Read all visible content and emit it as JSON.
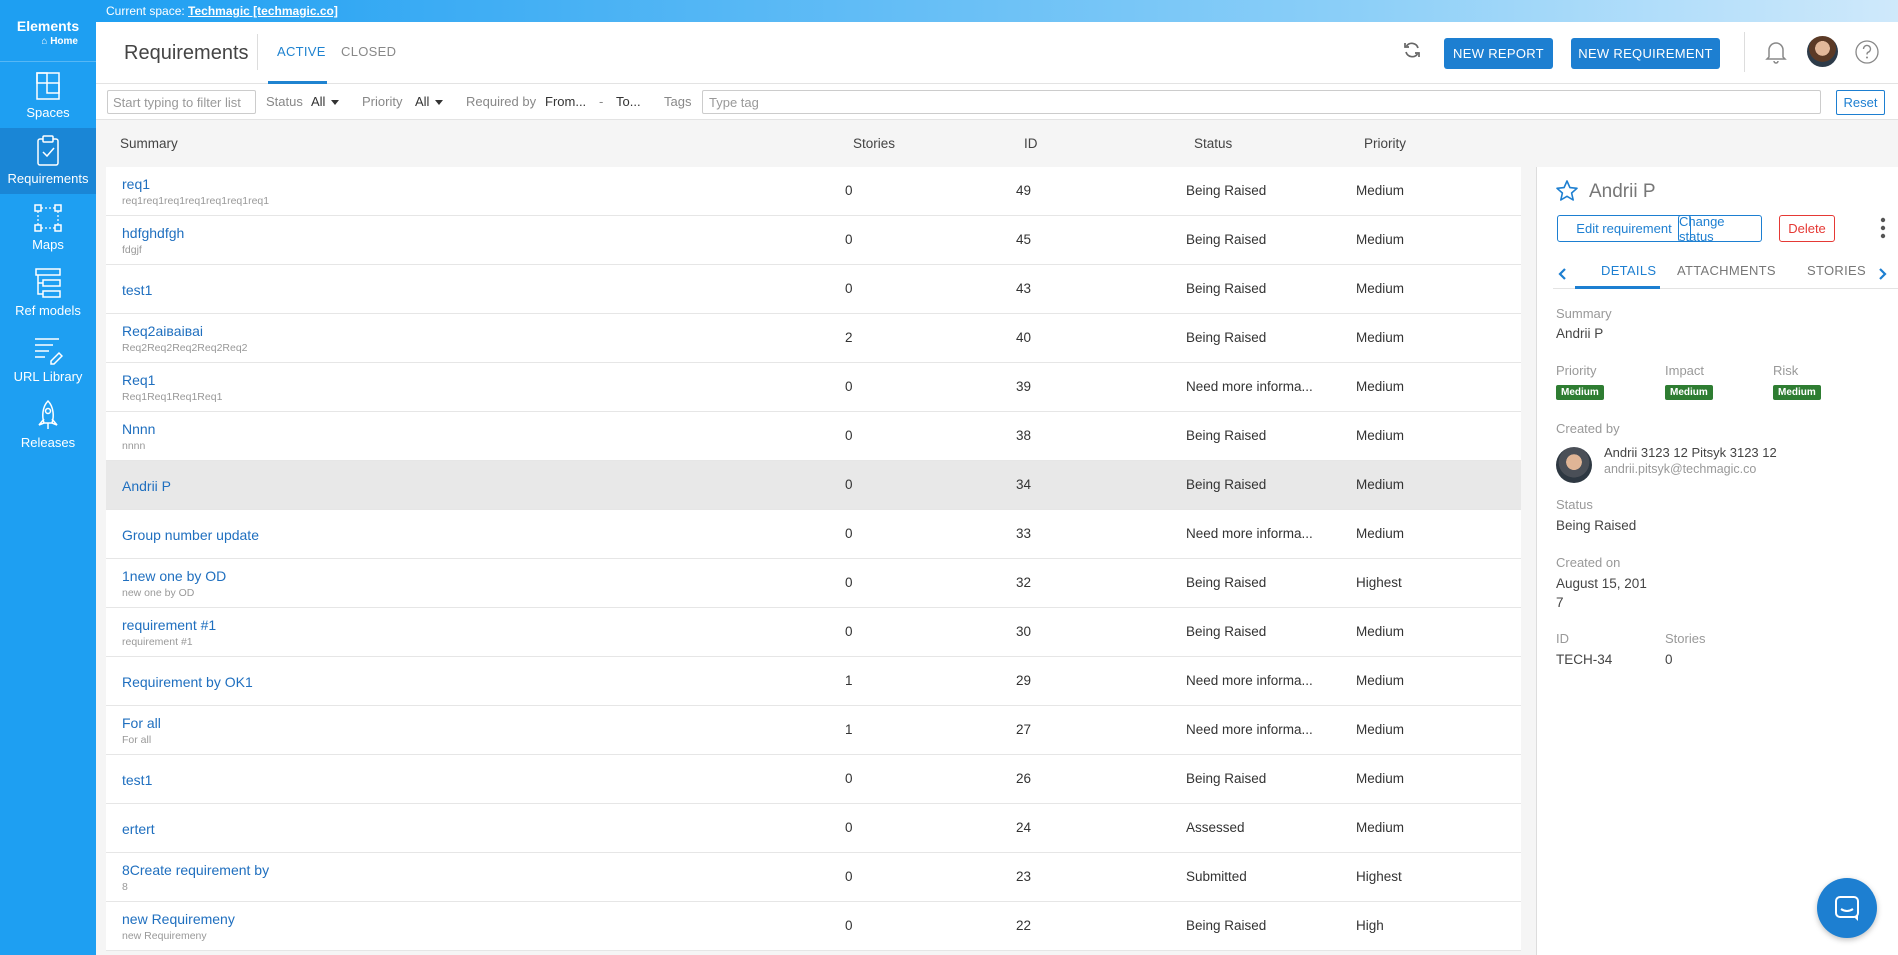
{
  "sidebar": {
    "brand": "Elements",
    "home": "Home",
    "items": [
      {
        "label": "Spaces",
        "icon": "spaces-icon"
      },
      {
        "label": "Requirements",
        "icon": "clipboard-icon"
      },
      {
        "label": "Maps",
        "icon": "maps-icon"
      },
      {
        "label": "Ref models",
        "icon": "ref-models-icon"
      },
      {
        "label": "URL Library",
        "icon": "url-library-icon"
      },
      {
        "label": "Releases",
        "icon": "rocket-icon"
      }
    ]
  },
  "space": {
    "prefix": "Current space:",
    "name": "Techmagic [techmagic.co]"
  },
  "header": {
    "title": "Requirements",
    "tabs": [
      "ACTIVE",
      "CLOSED"
    ],
    "new_report": "NEW REPORT",
    "new_requirement": "NEW REQUIREMENT"
  },
  "filters": {
    "search_placeholder": "Start typing to filter list",
    "status_label": "Status",
    "status_value": "All",
    "priority_label": "Priority",
    "priority_value": "All",
    "required_by_label": "Required by",
    "from": "From...",
    "dash": "-",
    "to": "To...",
    "tags_label": "Tags",
    "tags_placeholder": "Type tag",
    "reset": "Reset"
  },
  "table": {
    "columns": [
      "Summary",
      "Stories",
      "ID",
      "Status",
      "Priority"
    ],
    "rows": [
      {
        "summary": "req1",
        "sub": "req1req1req1req1req1req1req1",
        "stories": "0",
        "id": "49",
        "status": "Being Raised",
        "priority": "Medium"
      },
      {
        "summary": "hdfghdfgh",
        "sub": "fdgjf",
        "stories": "0",
        "id": "45",
        "status": "Being Raised",
        "priority": "Medium"
      },
      {
        "summary": "test1",
        "sub": "",
        "stories": "0",
        "id": "43",
        "status": "Being Raised",
        "priority": "Medium"
      },
      {
        "summary": "Req2aiвaiвai",
        "sub": "Req2Req2Req2Req2Req2",
        "stories": "2",
        "id": "40",
        "status": "Being Raised",
        "priority": "Medium"
      },
      {
        "summary": "Req1",
        "sub": "Req1Req1Req1Req1",
        "stories": "0",
        "id": "39",
        "status": "Need more informa...",
        "priority": "Medium"
      },
      {
        "summary": "Nnnn",
        "sub": "nnnn",
        "stories": "0",
        "id": "38",
        "status": "Being Raised",
        "priority": "Medium"
      },
      {
        "summary": "Andrii P",
        "sub": "",
        "stories": "0",
        "id": "34",
        "status": "Being Raised",
        "priority": "Medium"
      },
      {
        "summary": "Group number update",
        "sub": "",
        "stories": "0",
        "id": "33",
        "status": "Need more informa...",
        "priority": "Medium"
      },
      {
        "summary": "1new one by OD",
        "sub": "new one by OD",
        "stories": "0",
        "id": "32",
        "status": "Being Raised",
        "priority": "Highest"
      },
      {
        "summary": "requirement #1",
        "sub": "requirement #1",
        "stories": "0",
        "id": "30",
        "status": "Being Raised",
        "priority": "Medium"
      },
      {
        "summary": "Requirement by OK1",
        "sub": "",
        "stories": "1",
        "id": "29",
        "status": "Need more informa...",
        "priority": "Medium"
      },
      {
        "summary": "For all",
        "sub": "For all",
        "stories": "1",
        "id": "27",
        "status": "Need more informa...",
        "priority": "Medium"
      },
      {
        "summary": "test1",
        "sub": "",
        "stories": "0",
        "id": "26",
        "status": "Being Raised",
        "priority": "Medium"
      },
      {
        "summary": "ertert",
        "sub": "",
        "stories": "0",
        "id": "24",
        "status": "Assessed",
        "priority": "Medium"
      },
      {
        "summary": "8Create requirement by",
        "sub": "8",
        "stories": "0",
        "id": "23",
        "status": "Submitted",
        "priority": "Highest"
      },
      {
        "summary": "new Requiremeny",
        "sub": "new Requiremeny",
        "stories": "0",
        "id": "22",
        "status": "Being Raised",
        "priority": "High"
      }
    ],
    "selected_index": 6
  },
  "detail": {
    "title": "Andrii P",
    "edit": "Edit requirement",
    "change_status": "Change status",
    "delete": "Delete",
    "tabs": [
      "DETAILS",
      "ATTACHMENTS",
      "STORIES"
    ],
    "summary_label": "Summary",
    "summary_value": "Andrii P",
    "priority_label": "Priority",
    "priority_value": "Medium",
    "impact_label": "Impact",
    "impact_value": "Medium",
    "risk_label": "Risk",
    "risk_value": "Medium",
    "created_by_label": "Created by",
    "creator_name": "Andrii 3123 12 Pitsyk 3123 12",
    "creator_email": "andrii.pitsyk@techmagic.co",
    "status_label": "Status",
    "status_value": "Being Raised",
    "created_on_label": "Created on",
    "created_on_line1": "August 15, 201",
    "created_on_line2": "7",
    "id_label": "ID",
    "id_value": "TECH-34",
    "stories_label": "Stories",
    "stories_value": "0"
  },
  "colors": {
    "sidebar": "#1e9ff2",
    "primary": "#1d7fd1",
    "link": "#1f6fbf",
    "badge": "#2e7d32",
    "delete": "#e53935"
  }
}
